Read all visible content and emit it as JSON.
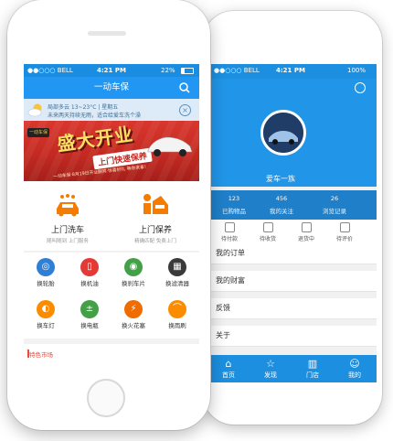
{
  "back_phone": {
    "status": {
      "carrier": "●●○○○ BELL",
      "time": "4:21 PM",
      "battery": "100%"
    },
    "username": "爱车一族",
    "stats": [
      {
        "value": "123",
        "label": "已购物品"
      },
      {
        "value": "456",
        "label": "我的关注"
      },
      {
        "value": "26",
        "label": "浏览记录"
      }
    ],
    "order_items": [
      "待付款",
      "待收货",
      "退货中",
      "待评价"
    ],
    "menu_items": [
      "我的订单",
      "我的财富",
      "反馈",
      "关于"
    ],
    "tabbar": [
      {
        "label": "首页",
        "icon": "home-icon"
      },
      {
        "label": "发现",
        "icon": "star-icon"
      },
      {
        "label": "门店",
        "icon": "store-icon"
      },
      {
        "label": "我的",
        "icon": "user-icon"
      }
    ]
  },
  "front_phone": {
    "status": {
      "carrier": "●●○○○ BELL",
      "time": "4:21 PM",
      "battery": "22%"
    },
    "app_title": "一动车保",
    "weather": {
      "line1": "局部多云  13~23°C  |  星期五",
      "line2": "未来两天持续无雨，适合给爱车洗个澡"
    },
    "banner": {
      "badge": "一动车保",
      "headline": "盛大开业",
      "subhead": "上门快速保养",
      "fine_print": "一动车保·8月19日开业酬宾·惊喜好礼 等你来拿！"
    },
    "services": [
      {
        "title": "上门洗车",
        "subtitle": "随叫随到 上门服务"
      },
      {
        "title": "上门保养",
        "subtitle": "精确匹配 免费上门"
      }
    ],
    "grid_items": [
      {
        "label": "换轮胎",
        "icon": "tire-icon",
        "color": "#2f7fd6"
      },
      {
        "label": "换机油",
        "icon": "oil-icon",
        "color": "#e53935"
      },
      {
        "label": "换刹车片",
        "icon": "brake-icon",
        "color": "#43a047"
      },
      {
        "label": "换滤清器",
        "icon": "filter-icon",
        "color": "#3a3a3a"
      },
      {
        "label": "换车灯",
        "icon": "headlight-icon",
        "color": "#fb8c00"
      },
      {
        "label": "换电瓶",
        "icon": "battery-icon",
        "color": "#43a047"
      },
      {
        "label": "换火花塞",
        "icon": "spark-plug-icon",
        "color": "#ef6c00"
      },
      {
        "label": "换雨刷",
        "icon": "wiper-icon",
        "color": "#fb8c00"
      }
    ],
    "market_title": "特色市场"
  },
  "colors": {
    "primary": "#2196f3",
    "orange": "#f57c00",
    "banner_red": "#c42a22"
  }
}
